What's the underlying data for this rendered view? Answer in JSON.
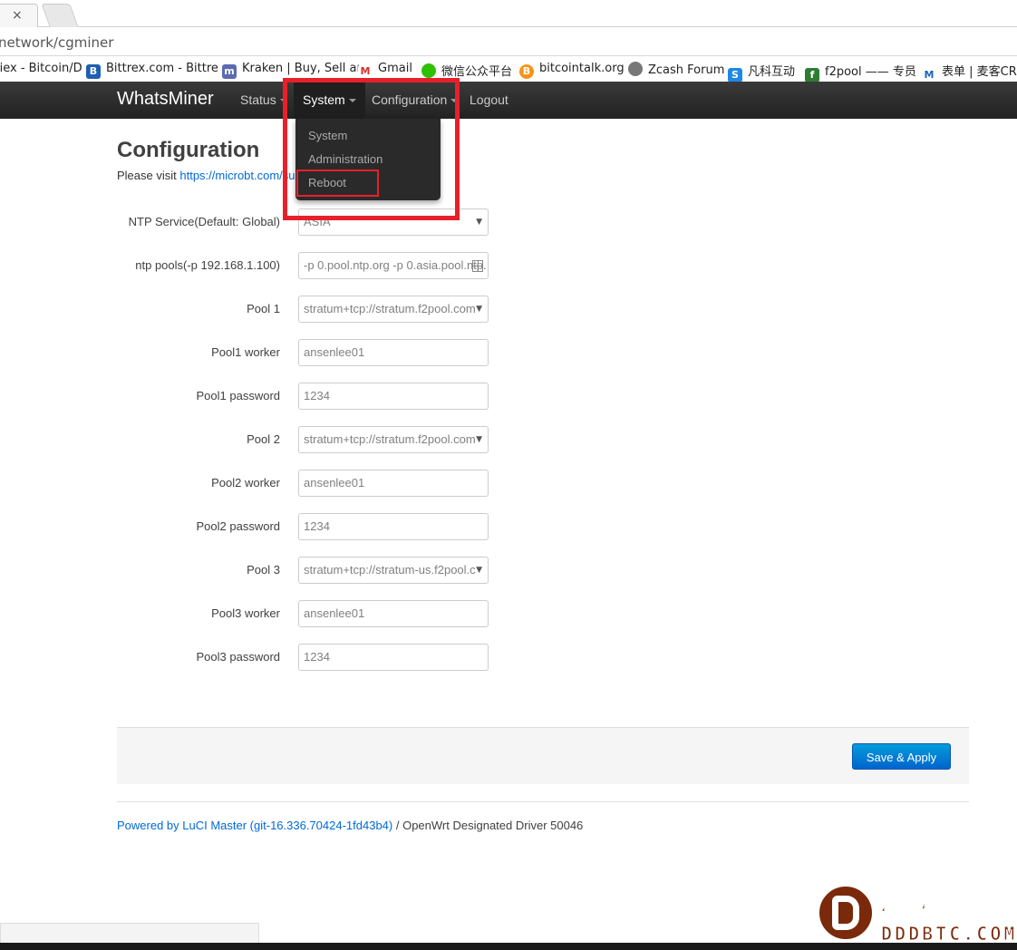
{
  "browser": {
    "tab_close": "×",
    "url": "network/cgminer",
    "bookmarks": [
      {
        "label": "iiex - Bitcoin/D",
        "icon": ""
      },
      {
        "label": "Bittrex.com - Bittre",
        "icon": "bittrex-icon"
      },
      {
        "label": "Kraken | Buy, Sell ar",
        "icon": "kraken-icon"
      },
      {
        "label": "Gmail",
        "icon": "gmail-icon"
      },
      {
        "label": "微信公众平台",
        "icon": "wechat-icon"
      },
      {
        "label": "bitcointalk.org",
        "icon": "bitcoin-icon"
      },
      {
        "label": "Zcash Forum",
        "icon": "zcash-icon"
      },
      {
        "label": "凡科互动",
        "icon": "fanke-icon"
      },
      {
        "label": "f2pool —— 专员",
        "icon": "f2pool-icon"
      },
      {
        "label": "表单 | 麦客CRM",
        "icon": "mike-icon"
      }
    ]
  },
  "navbar": {
    "brand": "WhatsMiner",
    "items": [
      {
        "label": "Status"
      },
      {
        "label": "System"
      },
      {
        "label": "Configuration"
      },
      {
        "label": "Logout"
      }
    ],
    "dropdown": [
      "System",
      "Administration",
      "Reboot"
    ]
  },
  "page": {
    "title": "Configuration",
    "desc_prefix": "Please visit ",
    "desc_link": "https://microbt.com/su"
  },
  "form": {
    "rows": [
      {
        "label": "NTP Service(Default: Global)",
        "value": "ASIA",
        "type": "select"
      },
      {
        "label": "ntp pools(-p 192.168.1.100)",
        "value": "-p 0.pool.ntp.org -p 0.asia.pool.ntp.",
        "type": "text-icon"
      },
      {
        "label": "Pool 1",
        "value": "stratum+tcp://stratum.f2pool.com",
        "type": "select"
      },
      {
        "label": "Pool1 worker",
        "value": "ansenlee01",
        "type": "text"
      },
      {
        "label": "Pool1 password",
        "value": "1234",
        "type": "text"
      },
      {
        "label": "Pool 2",
        "value": "stratum+tcp://stratum.f2pool.com",
        "type": "select"
      },
      {
        "label": "Pool2 worker",
        "value": "ansenlee01",
        "type": "text"
      },
      {
        "label": "Pool2 password",
        "value": "1234",
        "type": "text"
      },
      {
        "label": "Pool 3",
        "value": "stratum+tcp://stratum-us.f2pool.c",
        "type": "select"
      },
      {
        "label": "Pool3 worker",
        "value": "ansenlee01",
        "type": "text"
      },
      {
        "label": "Pool3 password",
        "value": "1234",
        "type": "text"
      }
    ],
    "select_arrow": "▼"
  },
  "actions": {
    "save_label": "Save & Apply"
  },
  "footer": {
    "link": "Powered by LuCI Master (git-16.336.70424-1fd43b4)",
    "suffix": " / OpenWrt Designated Driver 50046"
  },
  "watermark": {
    "main": "矿机商城",
    "sub": "DDDBTC.COM"
  },
  "colors": {
    "highlight": "#e8202a",
    "primary": "#0069d6",
    "navbar": "#222222"
  }
}
